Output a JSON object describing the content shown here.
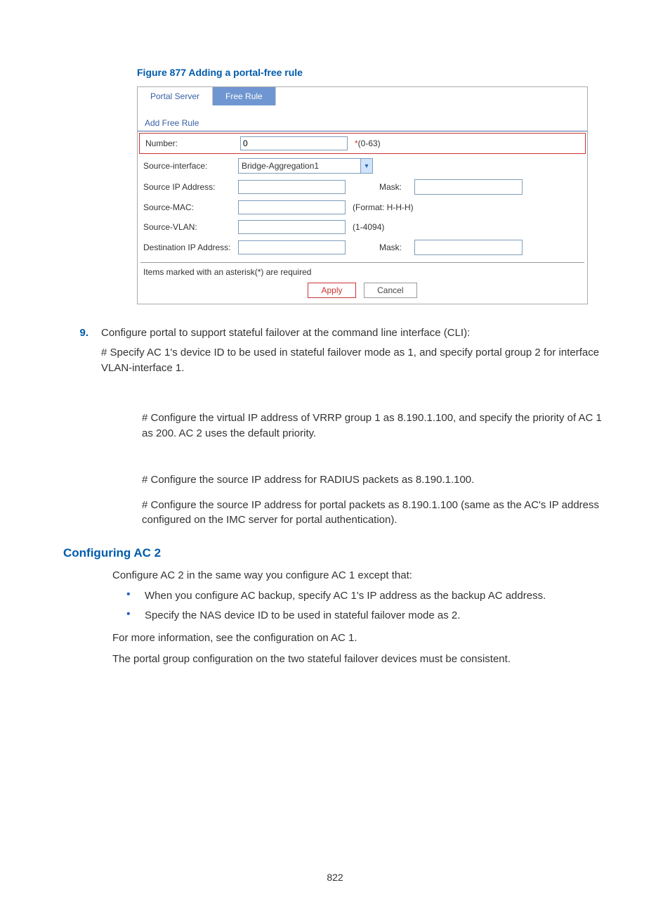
{
  "figure_caption": "Figure 877 Adding a portal-free rule",
  "screenshot": {
    "tabs": {
      "portal_server": "Portal Server",
      "free_rule": "Free Rule"
    },
    "section": "Add Free Rule",
    "fields": {
      "number": {
        "label": "Number:",
        "value": "0",
        "hint": "(0-63)",
        "star": "*"
      },
      "src_if": {
        "label": "Source-interface:",
        "value": "Bridge-Aggregation1"
      },
      "src_ip": {
        "label": "Source IP Address:",
        "mask_label": "Mask:"
      },
      "src_mac": {
        "label": "Source-MAC:",
        "hint": "(Format: H-H-H)"
      },
      "src_vlan": {
        "label": "Source-VLAN:",
        "hint": "(1-4094)"
      },
      "dst_ip": {
        "label": "Destination IP Address:",
        "mask_label": "Mask:"
      }
    },
    "required_note": "Items marked with an asterisk(*) are required",
    "buttons": {
      "apply": "Apply",
      "cancel": "Cancel"
    }
  },
  "step9": {
    "num": "9.",
    "line1": "Configure portal to support stateful failover at the command line interface (CLI):",
    "line2": "# Specify AC 1's device ID to be used in stateful failover mode as 1, and specify portal group 2 for interface VLAN-interface 1.",
    "line3": "# Configure the virtual IP address of VRRP group 1 as 8.190.1.100, and specify the priority of AC 1 as 200. AC 2 uses the default priority.",
    "line4": "# Configure the source IP address for RADIUS packets as 8.190.1.100.",
    "line5": "# Configure the source IP address for portal packets as 8.190.1.100 (same as the AC's IP address configured on the IMC server for portal authentication)."
  },
  "section_ac2": {
    "title": "Configuring AC 2",
    "intro": "Configure AC 2 in the same way you configure AC 1 except that:",
    "b1": "When you configure AC backup, specify AC 1's IP address as the backup AC address.",
    "b2": "Specify the NAS device ID to be used in stateful failover mode as 2.",
    "p1": "For more information, see the configuration on AC 1.",
    "p2": "The portal group configuration on the two stateful failover devices must be consistent."
  },
  "page_number": "822"
}
